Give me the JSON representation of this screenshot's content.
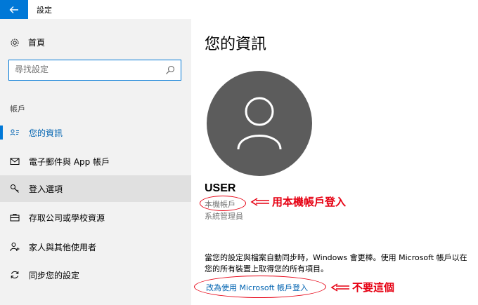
{
  "window": {
    "title": "設定"
  },
  "sidebar": {
    "home_label": "首頁",
    "search_placeholder": "尋找設定",
    "section_label": "帳戶",
    "items": [
      {
        "label": "您的資訊",
        "icon": "person-card-icon"
      },
      {
        "label": "電子郵件與 App 帳戶",
        "icon": "mail-icon"
      },
      {
        "label": "登入選項",
        "icon": "key-icon"
      },
      {
        "label": "存取公司或學校資源",
        "icon": "briefcase-icon"
      },
      {
        "label": "家人與其他使用者",
        "icon": "person-add-icon"
      },
      {
        "label": "同步您的設定",
        "icon": "sync-icon"
      }
    ]
  },
  "main": {
    "title": "您的資訊",
    "username": "USER",
    "account_type": "本機帳戶",
    "role": "系統管理員",
    "description": "當您的設定與檔案自動同步時，Windows 會更棒。使用 Microsoft 帳戶以在您的所有裝置上取得您的所有項目。",
    "ms_link": "改為使用 Microsoft 帳戶登入"
  },
  "annotations": {
    "local_account_note": "用本機帳戶登入",
    "ms_account_note": "不要這個"
  },
  "colors": {
    "accent": "#0078d7",
    "link": "#0063b1",
    "annotation": "#e60012",
    "avatar": "#5c5c5c"
  }
}
